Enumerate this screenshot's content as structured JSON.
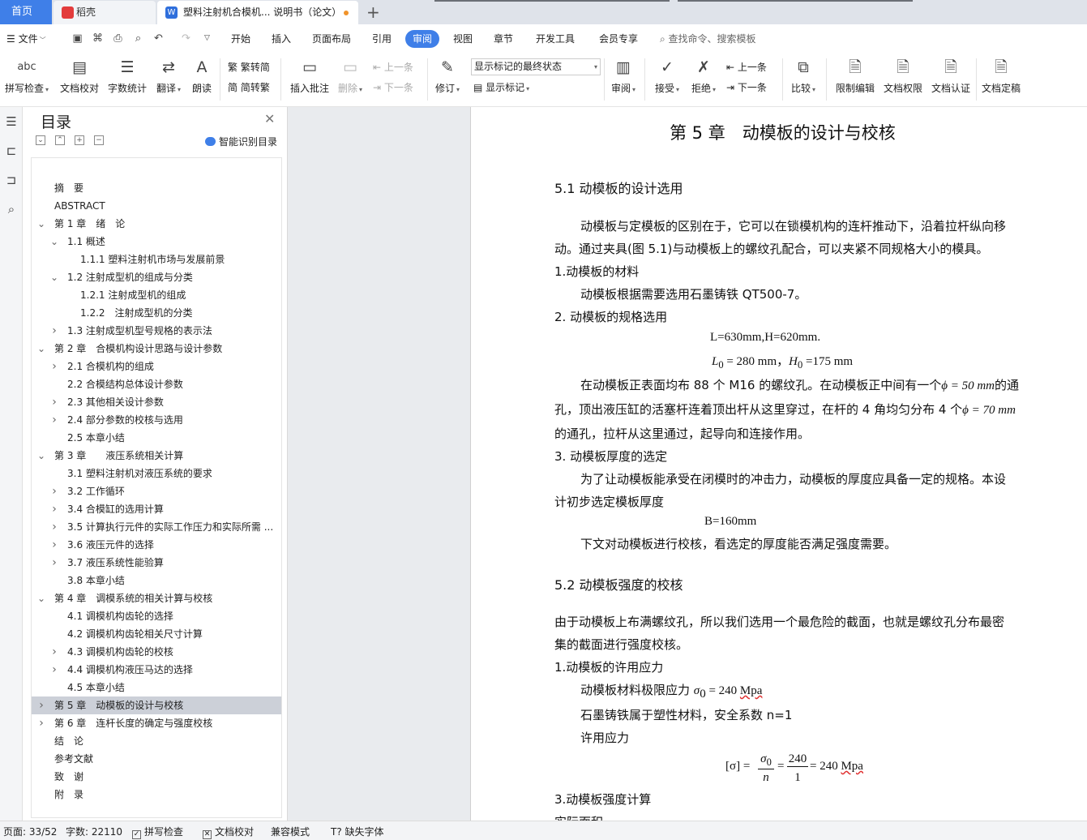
{
  "tabs": {
    "home": "首页",
    "daoke": "稻壳",
    "doc": "塑料注射机合模机... 说明书（论文）"
  },
  "menu": [
    "文件",
    "开始",
    "插入",
    "页面布局",
    "引用",
    "审阅",
    "视图",
    "章节",
    "开发工具",
    "会员专享"
  ],
  "search_placeholder": "查找命令、搜索模板",
  "ribbon": {
    "spell": "拼写检查",
    "proof": "文档校对",
    "count": "字数统计",
    "translate": "翻译",
    "read": "朗读",
    "trad": "繁转简",
    "simp": "简转繁",
    "comment": "插入批注",
    "delete": "删除",
    "prev_c": "上一条",
    "next_c": "下一条",
    "revise": "修订",
    "combo": "显示标记的最终状态",
    "show_marks": "显示标记",
    "review": "审阅",
    "accept": "接受",
    "reject": "拒绝",
    "prev": "上一条",
    "next": "下一条",
    "compare": "比较",
    "restrict": "限制编辑",
    "perm": "文档权限",
    "auth": "文档认证",
    "finalize": "文档定稿"
  },
  "toc": {
    "title": "目录",
    "smart": "智能识别目录",
    "items": [
      {
        "t": "摘　要",
        "lv": 0,
        "a": ""
      },
      {
        "t": "ABSTRACT",
        "lv": 0,
        "a": ""
      },
      {
        "t": "第 1 章　绪　论",
        "lv": 0,
        "a": "v"
      },
      {
        "t": "1.1 概述",
        "lv": 1,
        "a": "v"
      },
      {
        "t": "1.1.1 塑料注射机市场与发展前景",
        "lv": 2,
        "a": ""
      },
      {
        "t": "1.2 注射成型机的组成与分类",
        "lv": 1,
        "a": "v"
      },
      {
        "t": "1.2.1 注射成型机的组成",
        "lv": 2,
        "a": ""
      },
      {
        "t": "1.2.2　注射成型机的分类",
        "lv": 2,
        "a": ""
      },
      {
        "t": "1.3 注射成型机型号规格的表示法",
        "lv": 1,
        "a": ">"
      },
      {
        "t": "第 2 章　合模机构设计思路与设计参数",
        "lv": 0,
        "a": "v"
      },
      {
        "t": "2.1 合模机构的组成",
        "lv": 1,
        "a": ">"
      },
      {
        "t": "2.2 合模结构总体设计参数",
        "lv": 1,
        "a": ""
      },
      {
        "t": "2.3 其他相关设计参数",
        "lv": 1,
        "a": ">"
      },
      {
        "t": "2.4 部分参数的校核与选用",
        "lv": 1,
        "a": ">"
      },
      {
        "t": "2.5 本章小结",
        "lv": 1,
        "a": ""
      },
      {
        "t": "第 3 章　　液压系统相关计算",
        "lv": 0,
        "a": "v"
      },
      {
        "t": "3.1 塑料注射机对液压系统的要求",
        "lv": 1,
        "a": ""
      },
      {
        "t": "3.2 工作循环",
        "lv": 1,
        "a": ">"
      },
      {
        "t": "3.4 合模缸的选用计算",
        "lv": 1,
        "a": ">"
      },
      {
        "t": "3.5 计算执行元件的实际工作压力和实际所需 ...",
        "lv": 1,
        "a": ">"
      },
      {
        "t": "3.6 液压元件的选择",
        "lv": 1,
        "a": ">"
      },
      {
        "t": "3.7 液压系统性能验算",
        "lv": 1,
        "a": ">"
      },
      {
        "t": "3.8 本章小结",
        "lv": 1,
        "a": ""
      },
      {
        "t": "第 4 章　调模系统的相关计算与校核",
        "lv": 0,
        "a": "v"
      },
      {
        "t": "4.1 调模机构齿轮的选择",
        "lv": 1,
        "a": ""
      },
      {
        "t": "4.2 调模机构齿轮相关尺寸计算",
        "lv": 1,
        "a": ""
      },
      {
        "t": "4.3 调模机构齿轮的校核",
        "lv": 1,
        "a": ">"
      },
      {
        "t": "4.4 调模机构液压马达的选择",
        "lv": 1,
        "a": ">"
      },
      {
        "t": "4.5 本章小结",
        "lv": 1,
        "a": ""
      },
      {
        "t": "第 5 章　动模板的设计与校核",
        "lv": 0,
        "a": ">",
        "sel": true
      },
      {
        "t": "第 6 章　连杆长度的确定与强度校核",
        "lv": 0,
        "a": ">"
      },
      {
        "t": "结　论",
        "lv": 0,
        "a": ""
      },
      {
        "t": "参考文献",
        "lv": 0,
        "a": ""
      },
      {
        "t": "致　谢",
        "lv": 0,
        "a": ""
      },
      {
        "t": "附　录",
        "lv": 0,
        "a": ""
      }
    ]
  },
  "doc": {
    "chapter": "第 5 章　动模板的设计与校核",
    "s51": "5.1  动模板的设计选用",
    "p1a": "动模板与定模板的区别在于，它可以在锁模机构的连杆推动下，沿着拉杆纵向移",
    "p1b": "动。通过夹具(图 5.1)与动模板上的螺纹孔配合，可以夹紧不同规格大小的模具。",
    "h_mat": "1.动模板的材料",
    "p_mat": "动模板根据需要选用石墨铸铁 QT500-7。",
    "h_spec": "2. 动模板的规格选用",
    "eq1": "L=630mm,H=620mm.",
    "eq2_L": "L",
    "eq2_Lv": " = 280 mm，",
    "eq2_H": "H",
    "eq2_Hv": " =175 mm",
    "p3a_1": "在动模板正表面均布 88 个 M16 的螺纹孔。在动模板正中间有一个",
    "p3a_2": "ϕ = 50 mm",
    "p3a_3": "的通",
    "p3b_1": "孔，顶出液压缸的活塞杆连着顶出杆从这里穿过，在杆的 4 角均匀分布 4 个",
    "p3b_2": "ϕ = 70 mm",
    "p3c": "的通孔，拉杆从这里通过，起导向和连接作用。",
    "h_thick": "3. 动模板厚度的选定",
    "p4a": "为了让动模板能承受在闭模时的冲击力，动模板的厚度应具备一定的规格。本设",
    "p4b": "计初步选定模板厚度",
    "eq3": "B=160mm",
    "p5": "下文对动模板进行校核，看选定的厚度能否满足强度需要。",
    "s52": "5.2 动模板强度的校核",
    "p6a": "由于动模板上布满螺纹孔，所以我们选用一个最危险的截面，也就是螺纹孔分布最密",
    "p6b": "集的截面进行强度校核。",
    "h_allow": "1.动模板的许用应力",
    "p7_1": "动模板材料极限应力",
    "p7_m": "σ",
    "p7_2": " = 240 ",
    "p7_u": "Mpa",
    "p8": "石墨铸铁属于塑性材料，安全系数 n=1",
    "p9": "许用应力",
    "frac_lhs": "[σ] =",
    "frac_num1": "σ",
    "frac_den1": "n",
    "frac_num2": "240",
    "frac_den2": "1",
    "frac_rhs": "= 240 ",
    "frac_u": "Mpa",
    "h_calc": "3.动模板强度计算",
    "p_cut": "实际面积"
  },
  "status": {
    "page": "页面: 33/52",
    "words": "字数: 22110",
    "spell": "拼写检查",
    "proof": "文档校对",
    "compat": "兼容模式",
    "missing": "缺失字体"
  },
  "colors": {
    "accent": "#3f7fe8",
    "selected": "#ccd0d8",
    "canvas": "#e9ebee"
  }
}
